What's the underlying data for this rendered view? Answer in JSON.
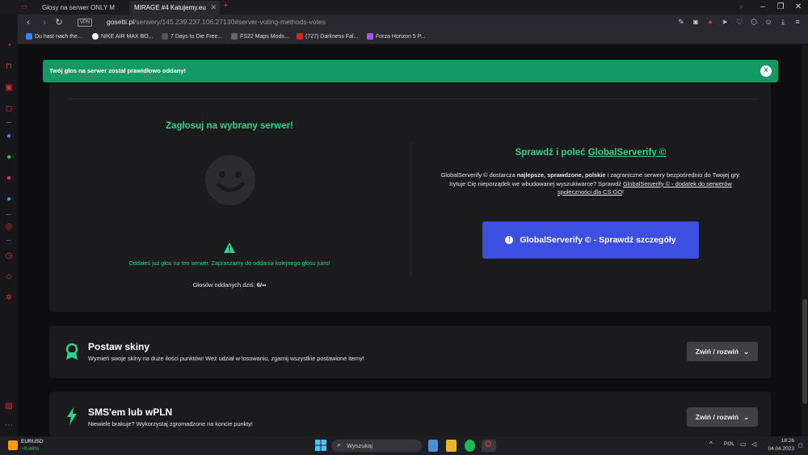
{
  "browser": {
    "tabs": [
      {
        "label": "Głosy na serwer ONLY M",
        "active": false
      },
      {
        "label": "MIRAGE #4 Katujemy.eu",
        "active": true
      }
    ],
    "url_host": "gosetti.pl",
    "url_path": "/serwery/145.239.237.106:27130#server-voting-methods-votes",
    "vpn_label": "VPN",
    "bookmarks": [
      "Du hast nach the...",
      "NIKE AIR MAX BO...",
      "7 Days to Die Free...",
      "FS22 Maps Mods...",
      "(727) Darkness Fal...",
      "Forza Horizon 5 P..."
    ]
  },
  "alert": {
    "message": "Twój głos na serwer został prawidłowo oddany!",
    "close_icon": "×"
  },
  "vote": {
    "heading": "Zagłosuj na wybrany serwer!",
    "notice": "Oddałeś już głos na ten serwer. Zapraszamy do oddania kolejnego głosu jutro!",
    "count_label": "Głosów oddanych dziś:",
    "count_value": "6/∞"
  },
  "promo": {
    "heading_prefix": "Sprawdź i poleć",
    "heading_link": "GlobalServerify ©",
    "text_1": "GlobalServerify © dostarcza",
    "bold_1": "najlepsze, sprawdzone, polskie",
    "text_2": "i zagraniczne serwery bezpośrednio do Twojej gry.",
    "text_3": "Irytuje Cię nieporządek we wbudowanej wyszukiwarce? Sprawdź",
    "link_2": "GlobalServerify © - dodatek do serwerów",
    "link_3": "społeczności dla CS:GO",
    "text_4": "!",
    "button": "GlobalServerify © - Sprawdź szczegóły"
  },
  "sections": [
    {
      "title": "Postaw skiny",
      "description": "Wymień swoje skiny na duże ilości punktów! Weź udział w losowaniu, zgarnij wszystkie postawione itemy!",
      "toggle": "Zwiń / rozwiń"
    },
    {
      "title": "SMS'em lub wPLN",
      "description": "Niewiele brakuje? Wykorzystaj zgromadzone na koncie punkty!",
      "toggle": "Zwiń / rozwiń"
    }
  ],
  "taskbar": {
    "ticker_symbol": "EURUSD",
    "ticker_change": "+0,48%",
    "search_placeholder": "Wyszukaj",
    "lang": "POL",
    "time": "18:26",
    "date": "04.04.2023"
  },
  "colors": {
    "accent_green": "#2fd38a",
    "alert_green": "#129a62",
    "button_blue": "#3d4fe0"
  }
}
